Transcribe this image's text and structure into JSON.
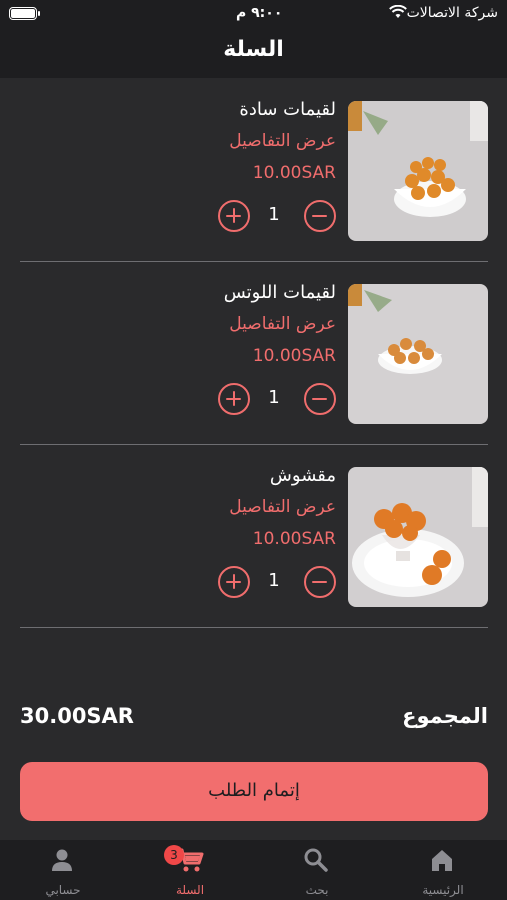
{
  "status_bar": {
    "carrier": "شركة الاتصالات",
    "time": "٩:٠٠ م",
    "battery_level": 1.0
  },
  "header": {
    "title": "السلة"
  },
  "cart": {
    "details_label": "عرض التفاصيل",
    "items": [
      {
        "name": "لقيمات سادة",
        "price": "10.00SAR",
        "quantity": "1",
        "image": "luqaimat-bowl-sesame"
      },
      {
        "name": "لقيمات اللوتس",
        "price": "10.00SAR",
        "quantity": "1",
        "image": "luqaimat-bowl-lotus"
      },
      {
        "name": "مقشوش",
        "price": "10.00SAR",
        "quantity": "1",
        "image": "maqshoosh-glass"
      }
    ]
  },
  "total": {
    "label": "المجموع",
    "value": "30.00SAR"
  },
  "checkout": {
    "label": "إتمام الطلب"
  },
  "tabbar": {
    "home": "الرئيسية",
    "search": "بحث",
    "cart": "السلة",
    "cart_badge": "3",
    "account": "حسابي",
    "active": "cart"
  },
  "colors": {
    "accent": "#f06d6d",
    "background": "#2a2a2c",
    "bar": "#1e1e20"
  }
}
